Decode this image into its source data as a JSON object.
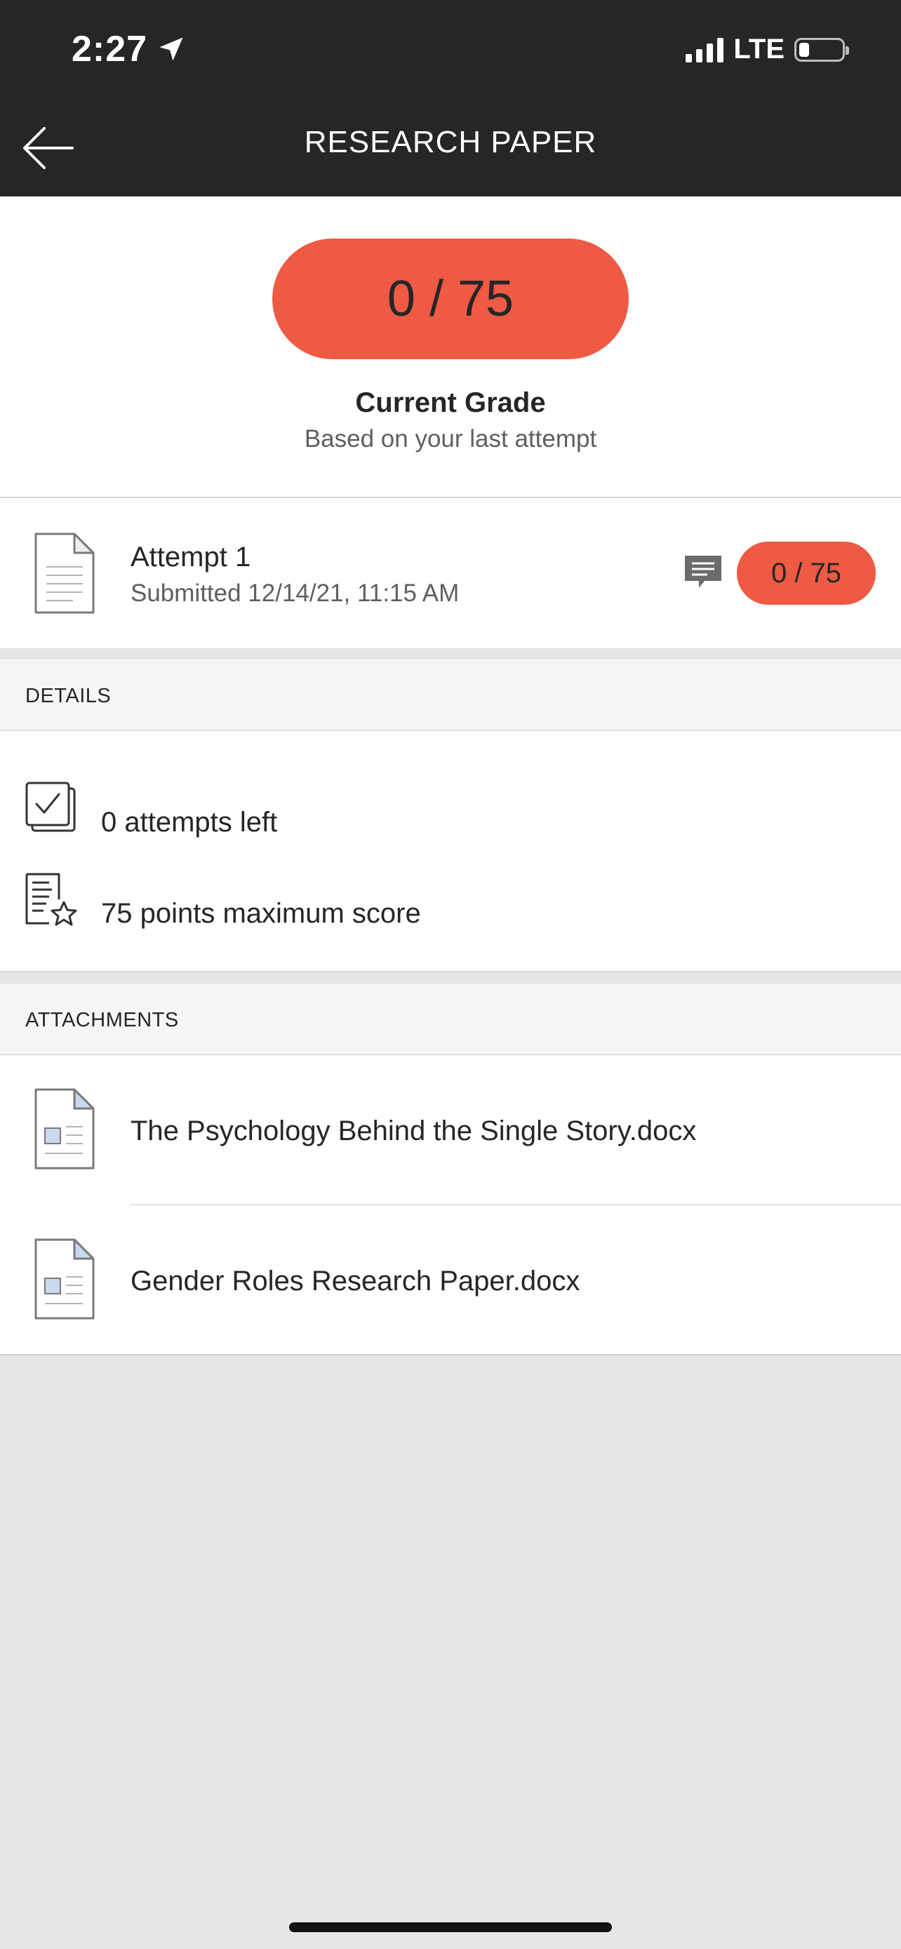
{
  "status_bar": {
    "time": "2:27",
    "network": "LTE"
  },
  "nav": {
    "title": "RESEARCH PAPER"
  },
  "grade": {
    "score": "0 / 75",
    "label": "Current Grade",
    "subtitle": "Based on your last attempt"
  },
  "attempt": {
    "title": "Attempt 1",
    "submitted": "Submitted 12/14/21, 11:15 AM",
    "score": "0 / 75"
  },
  "details": {
    "header": "DETAILS",
    "items": [
      {
        "icon": "attempts-checkbox-icon",
        "text": "0 attempts left"
      },
      {
        "icon": "score-star-icon",
        "text": "75 points maximum score"
      }
    ]
  },
  "attachments": {
    "header": "ATTACHMENTS",
    "items": [
      {
        "icon": "docx-file-icon",
        "name": "The Psychology Behind the Single Story.docx"
      },
      {
        "icon": "docx-file-icon",
        "name": "Gender Roles Research Paper.docx"
      }
    ]
  },
  "colors": {
    "accent": "#ee5a44",
    "header_bg": "#262626",
    "page_bg": "#e6e6e6"
  }
}
